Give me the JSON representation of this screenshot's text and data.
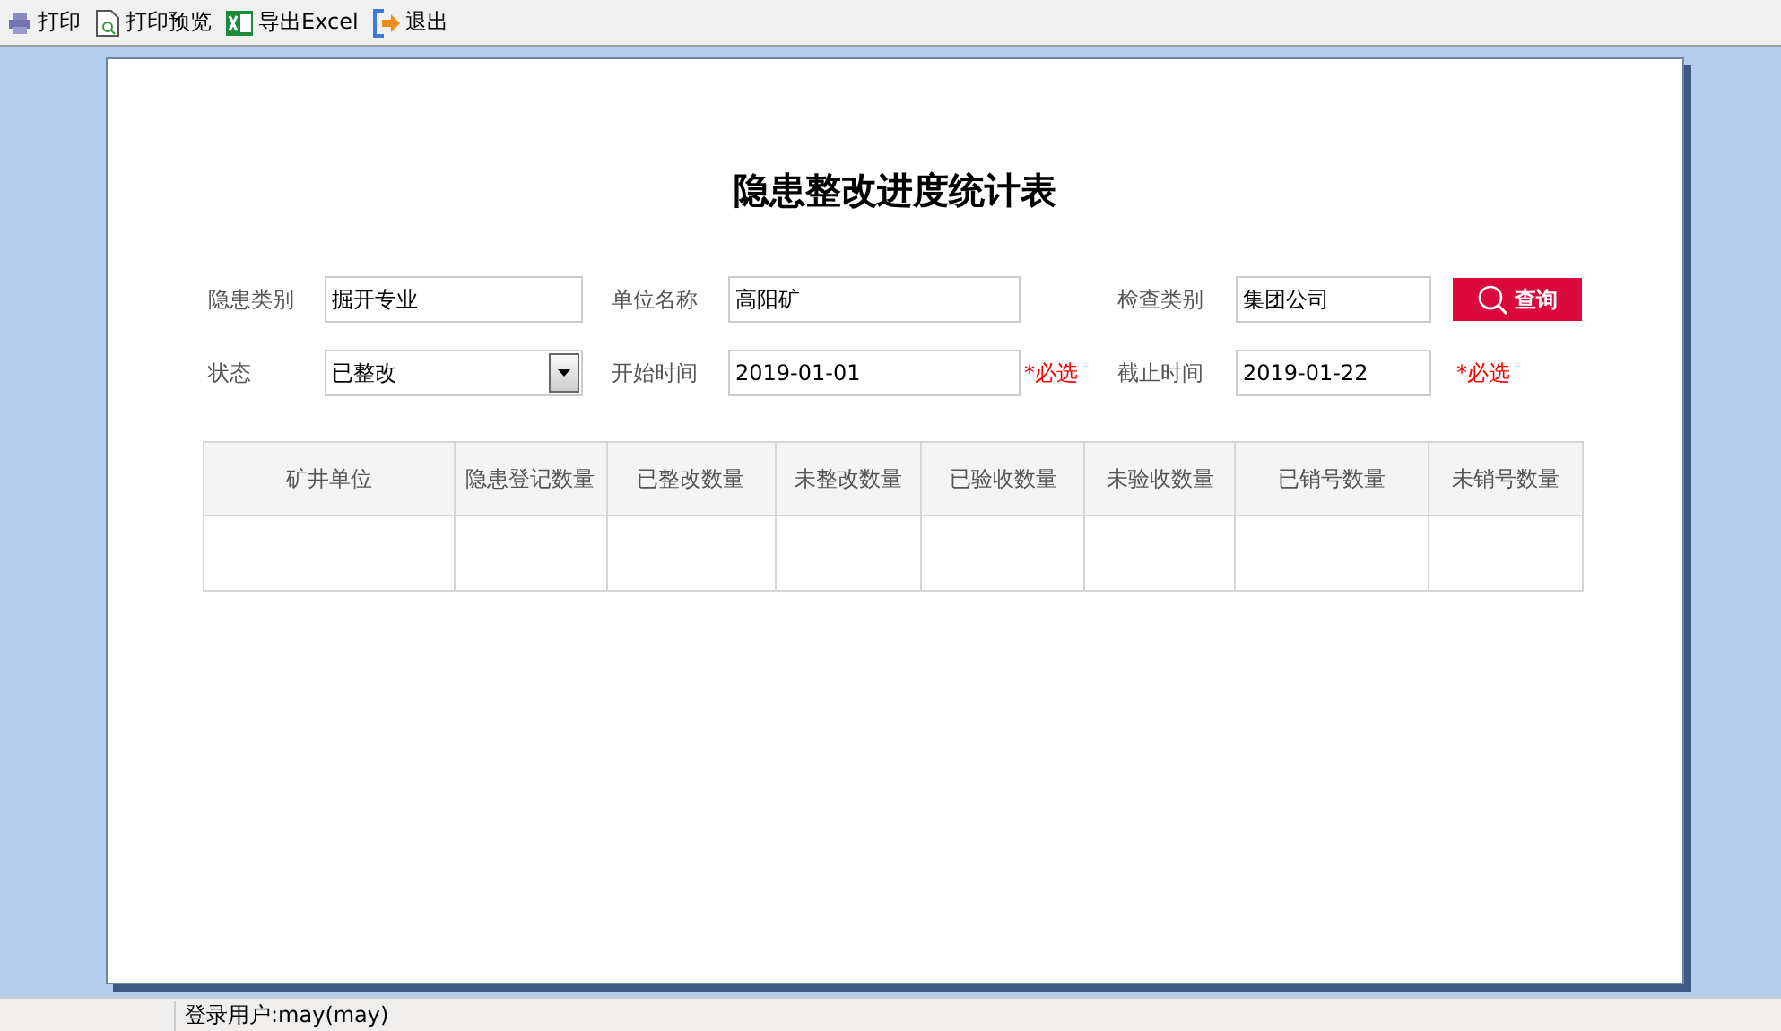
{
  "toolbar": [
    {
      "label": "打印",
      "kind": "print"
    },
    {
      "label": "打印预览",
      "kind": "preview"
    },
    {
      "label": "导出Excel",
      "kind": "excel"
    },
    {
      "label": "退出",
      "kind": "exit"
    }
  ],
  "report": {
    "title": "隐患整改进度统计表",
    "filters": [
      {
        "label": "隐患类别",
        "kind": "text",
        "value": "掘开专业"
      },
      {
        "label": "单位名称",
        "kind": "text",
        "value": "高阳矿"
      },
      {
        "label": "检查类别",
        "kind": "text",
        "value": "集团公司"
      },
      {
        "label": "状态",
        "kind": "select",
        "value": "已整改"
      },
      {
        "label": "开始时间",
        "kind": "date",
        "value": "2019-01-01",
        "required": "*必选"
      },
      {
        "label": "截止时间",
        "kind": "date",
        "value": "2019-01-22",
        "required": "*必选"
      }
    ],
    "query_button": "查询",
    "table": {
      "columns": [
        "矿井单位",
        "隐患登记数量",
        "已整改数量",
        "未整改数量",
        "已验收数量",
        "未验收数量",
        "已销号数量",
        "未销号数量"
      ]
    }
  },
  "status_bar": {
    "user": "登录用户:may(may)"
  }
}
